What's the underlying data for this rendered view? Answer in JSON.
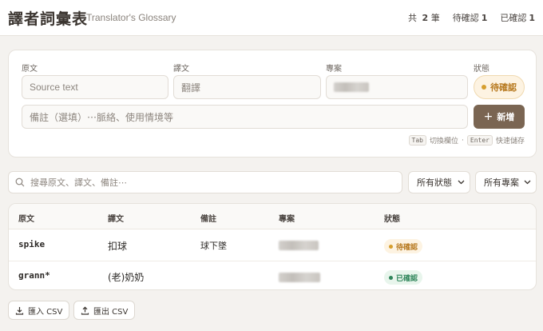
{
  "header": {
    "title": "譯者詞彙表",
    "subtitle": "Translator's Glossary",
    "stats": [
      {
        "label": "共",
        "value": "2",
        "suffix": "筆"
      },
      {
        "label": "待確認",
        "value": "1",
        "suffix": ""
      },
      {
        "label": "已確認",
        "value": "1",
        "suffix": ""
      }
    ]
  },
  "form": {
    "source_label": "原文",
    "source_placeholder": "Source text",
    "target_label": "譯文",
    "target_placeholder": "翻譯",
    "project_label": "專案",
    "status_label": "狀態",
    "status_value": "待確認",
    "note_placeholder": "備註（選填）⋯脈絡、使用情境等",
    "add_label": "新增",
    "hint_key1": "Tab",
    "hint_text1": "切換欄位",
    "hint_sep": "·",
    "hint_key2": "Enter",
    "hint_text2": "快速儲存"
  },
  "filters": {
    "search_placeholder": "搜尋原文、譯文、備註⋯",
    "status_select": "所有狀態",
    "project_select": "所有專案"
  },
  "table": {
    "columns": [
      "原文",
      "譯文",
      "備註",
      "專案",
      "狀態"
    ],
    "rows": [
      {
        "source": "spike",
        "target": "扣球",
        "note": "球下墜",
        "status": "待確認"
      },
      {
        "source": "grann*",
        "target": "(老)奶奶",
        "note": "",
        "status": "已確認"
      }
    ]
  },
  "actions": {
    "import_label": "匯入 CSV",
    "export_label": "匯出 CSV"
  },
  "colors": {
    "pending": "#d69e2e",
    "confirmed": "#2f855a",
    "accent": "#7a6552"
  }
}
